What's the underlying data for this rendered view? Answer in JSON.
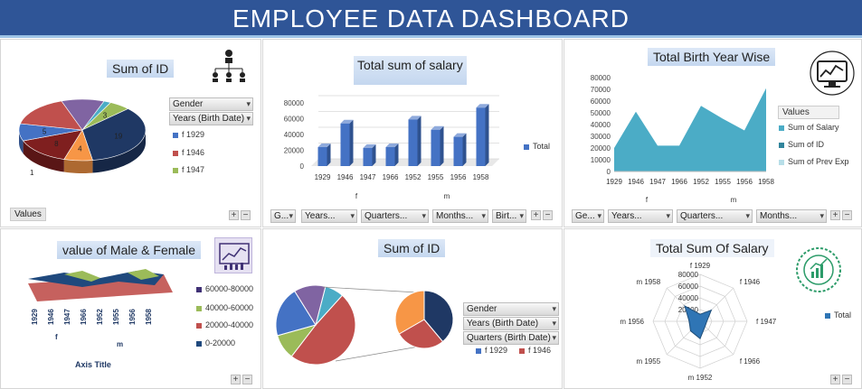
{
  "banner": {
    "title": "EMPLOYEE  DATA DASHBOARD"
  },
  "colors": {
    "banner": "#2f5597",
    "bar": "#4472c4",
    "area": "#4bacc6",
    "pie1": "#4472c4",
    "pie2": "#c0504d",
    "pie3": "#9bbb59",
    "pie4": "#8064a2",
    "pie5": "#4bacc6",
    "pie6": "#f79646",
    "pie7": "#1f3864",
    "pie8": "#7f1f1f"
  },
  "panel1": {
    "title": "Sum of ID",
    "filters": [
      "Gender",
      "Years (Birth Date)"
    ],
    "legend": [
      "f 1929",
      "f 1946",
      "f 1947"
    ],
    "values_button": "Values",
    "chart_data": {
      "type": "pie",
      "title": "Sum of ID",
      "slices": [
        {
          "label": "1",
          "value": 1
        },
        {
          "label": "3",
          "value": 3
        },
        {
          "label": "19",
          "value": 19
        },
        {
          "label": "4",
          "value": 4
        },
        {
          "label": "8",
          "value": 8
        },
        {
          "label": "5",
          "value": 5
        },
        {
          "label": "",
          "value": 9
        },
        {
          "label": "",
          "value": 6
        }
      ]
    }
  },
  "panel2": {
    "title": "Total sum of salary",
    "filters": [
      "G...",
      "Years...",
      "Quarters...",
      "Months...",
      "Birt..."
    ],
    "legend": [
      "Total"
    ],
    "chart_data": {
      "type": "bar",
      "categories": [
        "1929",
        "1946",
        "1947",
        "1966",
        "1952",
        "1955",
        "1956",
        "1958"
      ],
      "groups": [
        "f",
        "m"
      ],
      "values": [
        24000,
        54000,
        23000,
        24000,
        59000,
        46000,
        37000,
        74000
      ],
      "ylim": [
        0,
        80000
      ],
      "yticks": [
        "0",
        "20000",
        "40000",
        "60000",
        "80000"
      ]
    }
  },
  "panel3": {
    "title": "Total Birth Year Wise",
    "filters": [
      "Ge...",
      "Years...",
      "Quarters...",
      "Months..."
    ],
    "legend_header": "Values",
    "legend": [
      "Sum of Salary",
      "Sum of ID",
      "Sum of Prev Exp"
    ],
    "chart_data": {
      "type": "area",
      "categories": [
        "1929",
        "1946",
        "1947",
        "1966",
        "1952",
        "1955",
        "1956",
        "1958"
      ],
      "groups": [
        "f",
        "m"
      ],
      "values": [
        20000,
        51000,
        22000,
        22000,
        56000,
        45000,
        35000,
        71000
      ],
      "ylim": [
        0,
        80000
      ],
      "yticks": [
        "0",
        "10000",
        "20000",
        "30000",
        "40000",
        "50000",
        "60000",
        "70000",
        "80000"
      ]
    }
  },
  "panel4": {
    "title": "value of Male & Female",
    "legend": [
      "60000-80000",
      "40000-60000",
      "20000-40000",
      "0-20000"
    ],
    "axis_title": "Axis Title",
    "categories": [
      "1929",
      "1946",
      "1947",
      "1966",
      "1952",
      "1955",
      "1956",
      "1958"
    ],
    "groups": [
      "f",
      "m"
    ]
  },
  "panel5": {
    "title": "Sum of ID",
    "filters": [
      "Gender",
      "Years (Birth Date)",
      "Quarters (Birth Date)"
    ],
    "legend": [
      "f 1929",
      "f 1946"
    ],
    "chart_data": {
      "type": "pie",
      "main_slices": [
        3,
        19,
        4,
        8,
        5
      ],
      "sub_slices": [
        7,
        5,
        6
      ]
    }
  },
  "panel6": {
    "title": "Total Sum Of Salary",
    "legend": [
      "Total"
    ],
    "chart_data": {
      "type": "radar",
      "categories": [
        "f 1929",
        "f 1946",
        "f 1947",
        "f 1966",
        "m 1952",
        "m 1955",
        "m 1956",
        "m 1958"
      ],
      "values": [
        24000,
        54000,
        23000,
        24000,
        59000,
        46000,
        37000,
        74000
      ],
      "ticks": [
        "0",
        "20000",
        "40000",
        "60000",
        "80000"
      ]
    }
  },
  "controls": {
    "plus": "+",
    "minus": "−"
  }
}
